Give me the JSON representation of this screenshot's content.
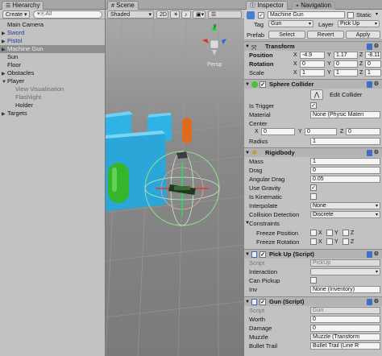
{
  "hierarchy": {
    "tab": "Hierarchy",
    "create": "Create",
    "search": "▾ⓀAll",
    "items": [
      {
        "label": "Main Camera",
        "style": "",
        "indent": 0,
        "arrow": ""
      },
      {
        "label": "Sword",
        "style": "blue",
        "indent": 0,
        "arrow": "▶"
      },
      {
        "label": "Pistol",
        "style": "blue",
        "indent": 0,
        "arrow": "▶"
      },
      {
        "label": "Machine Gun",
        "style": "sel",
        "indent": 0,
        "arrow": "▶"
      },
      {
        "label": "Sun",
        "style": "",
        "indent": 0,
        "arrow": ""
      },
      {
        "label": "Floor",
        "style": "",
        "indent": 0,
        "arrow": ""
      },
      {
        "label": "Obstacles",
        "style": "",
        "indent": 0,
        "arrow": "▶"
      },
      {
        "label": "Player",
        "style": "",
        "indent": 0,
        "arrow": "▼"
      },
      {
        "label": "View Visualisation",
        "style": "gray",
        "indent": 1,
        "arrow": ""
      },
      {
        "label": "Flashlight",
        "style": "gray",
        "indent": 1,
        "arrow": ""
      },
      {
        "label": "Holder",
        "style": "",
        "indent": 1,
        "arrow": ""
      },
      {
        "label": "Targets",
        "style": "",
        "indent": 0,
        "arrow": "▶"
      }
    ]
  },
  "scene": {
    "tab": "Scene",
    "shading": "Shaded",
    "mode2d": "2D",
    "gizmo_label": "Persp",
    "gizmo_axis": "y"
  },
  "inspector": {
    "tab": "Inspector",
    "tab2": "Navigation",
    "object_name": "Machine Gun",
    "static_label": "Static",
    "tag_label": "Tag",
    "tag_value": "Gun",
    "layer_label": "Layer",
    "layer_value": "Pick Up",
    "prefab_label": "Prefab",
    "prefab_select": "Select",
    "prefab_revert": "Revert",
    "prefab_apply": "Apply",
    "transform": {
      "title": "Transform",
      "position_label": "Position",
      "rotation_label": "Rotation",
      "scale_label": "Scale",
      "x": "X",
      "y": "Y",
      "z": "Z",
      "pos": [
        "-4.9",
        "1.17",
        "-8.11"
      ],
      "rot": [
        "0",
        "0",
        "0"
      ],
      "scale": [
        "1",
        "1",
        "1"
      ]
    },
    "sphere": {
      "title": "Sphere Collider",
      "edit": "Edit Collider",
      "trigger_label": "Is Trigger",
      "material_label": "Material",
      "material_value": "None (Physic Materi",
      "center_label": "Center",
      "center": [
        "0",
        "0",
        "0"
      ],
      "radius_label": "Radius",
      "radius_value": "1"
    },
    "rigidbody": {
      "title": "Rigidbody",
      "mass_label": "Mass",
      "mass": "1",
      "drag_label": "Drag",
      "drag": "0",
      "adrag_label": "Angular Drag",
      "adrag": "0.05",
      "gravity_label": "Use Gravity",
      "kinematic_label": "Is Kinematic",
      "interp_label": "Interpolate",
      "interp": "None",
      "collision_label": "Collision Detection",
      "collision": "Discrete",
      "constraints_label": "Constraints",
      "freeze_pos_label": "Freeze Position",
      "freeze_rot_label": "Freeze Rotation"
    },
    "pickup": {
      "title": "Pick Up (Script)",
      "script_label": "Script",
      "script": "PickUp",
      "interaction_label": "Interaction",
      "can_pickup_label": "Can Pickup",
      "inv_label": "Inv",
      "inv": "None (Inventory)"
    },
    "gun": {
      "title": "Gun (Script)",
      "script_label": "Script",
      "script": "Gun",
      "worth_label": "Worth",
      "worth": "0",
      "damage_label": "Damage",
      "damage": "0",
      "muzzle_label": "Muzzle",
      "muzzle": "Muzzle (Transform",
      "bullet_label": "Bullet Trail",
      "bullet": "Bullet Trail (Line R"
    }
  },
  "colors": {
    "cube": "#2fb3e6",
    "capsule_green": "#35b52a",
    "capsule_orange": "#e06b1f",
    "floor": "#8a8a8a"
  }
}
